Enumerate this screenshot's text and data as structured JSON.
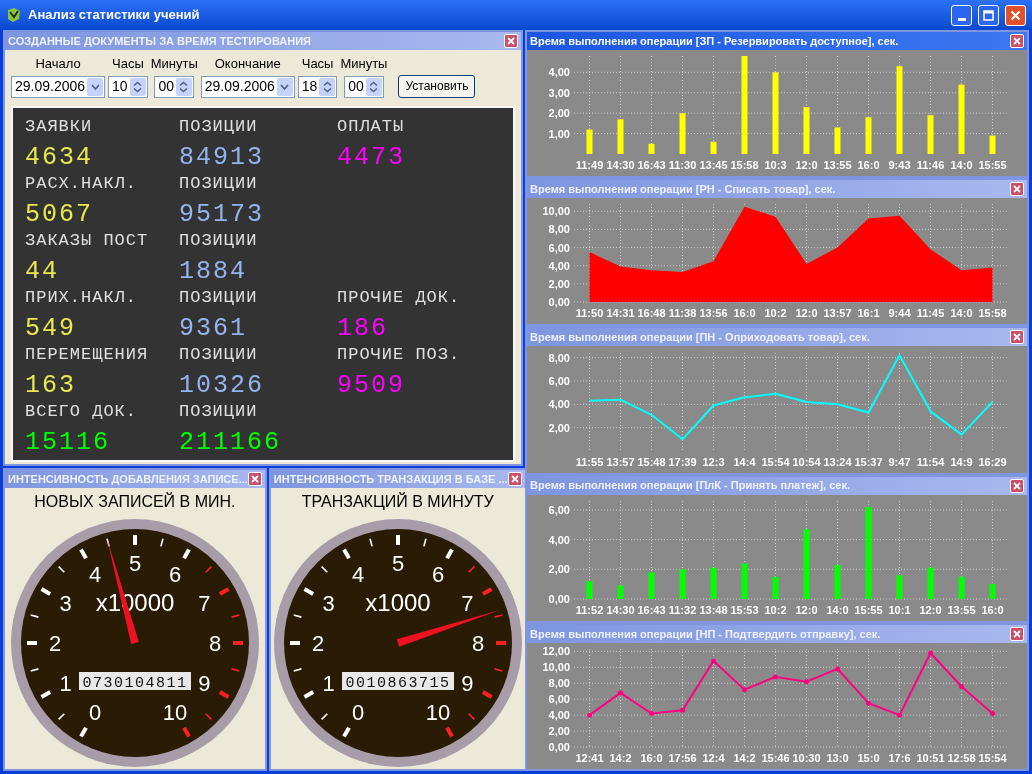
{
  "window": {
    "title": "Анализ статистики учений"
  },
  "documents_panel": {
    "title": "СОЗДАННЫЕ ДОКУМЕНТЫ ЗА ВРЕМЯ ТЕСТИРОВАНИЯ",
    "fields": [
      {
        "kind": "date",
        "label": "Начало",
        "value": "29.09.2006"
      },
      {
        "kind": "spin",
        "label": "Часы",
        "value": "10"
      },
      {
        "kind": "spin",
        "label": "Минуты",
        "value": "00"
      },
      {
        "kind": "date",
        "label": "Окончание",
        "value": "29.09.2006"
      },
      {
        "kind": "spin",
        "label": "Часы",
        "value": "18"
      },
      {
        "kind": "spin",
        "label": "Минуты",
        "value": "00"
      }
    ],
    "button": "Установить",
    "display": [
      {
        "cells": [
          {
            "label": "ЗАЯВКИ",
            "value": "4634",
            "color": "#e8e850"
          },
          {
            "label": "ПОЗИЦИИ",
            "value": "84913",
            "color": "#94b4f0"
          },
          {
            "label": "ОПЛАТЫ",
            "value": "4473",
            "color": "#ff00ff"
          }
        ]
      },
      {
        "cells": [
          {
            "label": "РАСХ.НАКЛ.",
            "value": "5067",
            "color": "#e8e850"
          },
          {
            "label": "ПОЗИЦИИ",
            "value": "95173",
            "color": "#94b4f0"
          }
        ]
      },
      {
        "cells": [
          {
            "label": "ЗАКАЗЫ ПОСТ",
            "value": "44",
            "color": "#e8e850"
          },
          {
            "label": "ПОЗИЦИИ",
            "value": "1884",
            "color": "#94b4f0"
          }
        ]
      },
      {
        "cells": [
          {
            "label": "ПРИХ.НАКЛ.",
            "value": "549",
            "color": "#e8e850"
          },
          {
            "label": "ПОЗИЦИИ",
            "value": "9361",
            "color": "#94b4f0"
          },
          {
            "label": "ПРОЧИЕ ДОК.",
            "value": "186",
            "color": "#ff00ff"
          }
        ]
      },
      {
        "cells": [
          {
            "label": "ПЕРЕМЕЩЕНИЯ",
            "value": "163",
            "color": "#e8e850"
          },
          {
            "label": "ПОЗИЦИИ",
            "value": "10326",
            "color": "#94b4f0"
          },
          {
            "label": "ПРОЧИЕ ПОЗ.",
            "value": "9509",
            "color": "#ff00ff"
          }
        ]
      },
      {
        "cells": [
          {
            "label": "ВСЕГО ДОК.",
            "value": "15116",
            "color": "#00ff00"
          },
          {
            "label": "ПОЗИЦИИ",
            "value": "211166",
            "color": "#00ff00"
          }
        ]
      }
    ]
  },
  "gauges": [
    {
      "title": "ИНТЕНСИВНОСТЬ ДОБАВЛЕНИЯ ЗАПИСЕ...",
      "caption": "НОВЫХ ЗАПИСЕЙ В МИН.",
      "multiplier": "x10000",
      "counter": "0730104811",
      "level": 0.45,
      "scale": [
        {
          "text": "0",
          "color": "#ffffff"
        },
        {
          "text": "1",
          "color": "#ffffff"
        },
        {
          "text": "2",
          "color": "#ffffff"
        },
        {
          "text": "3",
          "color": "#ffffff"
        },
        {
          "text": "4",
          "color": "#ffffff"
        },
        {
          "text": "5",
          "color": "#ffffff"
        },
        {
          "text": "6",
          "color": "#ffffff"
        },
        {
          "text": "7",
          "color": "#ff2020"
        },
        {
          "text": "8",
          "color": "#ff2020"
        },
        {
          "text": "9",
          "color": "#ff2020"
        },
        {
          "text": "10",
          "color": "#ff2020"
        }
      ]
    },
    {
      "title": "ИНТЕНСИВНОСТЬ ТРАНЗАКЦИЯ В БАЗЕ ...",
      "caption": "ТРАНЗАКЦИЙ В МИНУТУ",
      "multiplier": "x1000",
      "counter": "0010863715",
      "level": 0.74,
      "scale": [
        {
          "text": "0",
          "color": "#ffffff"
        },
        {
          "text": "1",
          "color": "#ffffff"
        },
        {
          "text": "2",
          "color": "#ffffff"
        },
        {
          "text": "3",
          "color": "#ffffff"
        },
        {
          "text": "4",
          "color": "#ffffff"
        },
        {
          "text": "5",
          "color": "#ffffff"
        },
        {
          "text": "6",
          "color": "#ffffff"
        },
        {
          "text": "7",
          "color": "#ff2020"
        },
        {
          "text": "8",
          "color": "#ff2020"
        },
        {
          "text": "9",
          "color": "#ff2020"
        },
        {
          "text": "10",
          "color": "#ff2020"
        }
      ]
    }
  ],
  "charts": [
    {
      "title": "Время выполнения операции  [ЗП - Резервировать доступное], сек.",
      "active": true,
      "chart_data": {
        "type": "bar",
        "grid": true,
        "ylim": [
          0,
          4.8
        ],
        "yticks": [
          {
            "value": 1,
            "label": "1,00"
          },
          {
            "value": 2,
            "label": "2,00"
          },
          {
            "value": 3,
            "label": "3,00"
          },
          {
            "value": 4,
            "label": "4,00"
          }
        ],
        "categories": [
          "11:49",
          "14:30",
          "16:43",
          "11:30",
          "13:45",
          "15:58",
          "10:3",
          "12:0",
          "13:55",
          "16:0",
          "9:43",
          "11:46",
          "14:0",
          "15:55"
        ],
        "series": [
          {
            "color": "#ffff00",
            "values": [
              1.2,
              1.7,
              0.5,
              2.0,
              0.6,
              4.8,
              4.0,
              2.3,
              1.3,
              1.8,
              4.3,
              1.9,
              3.4,
              0.9
            ]
          }
        ]
      }
    },
    {
      "title": "Время выполнения операции  [РН - Списать товар], сек.",
      "active": false,
      "chart_data": {
        "type": "area",
        "grid": true,
        "ylim": [
          0,
          10.8
        ],
        "yticks": [
          {
            "value": 0,
            "label": "0,00"
          },
          {
            "value": 2,
            "label": "2,00"
          },
          {
            "value": 4,
            "label": "4,00"
          },
          {
            "value": 6,
            "label": "6,00"
          },
          {
            "value": 8,
            "label": "8,00"
          },
          {
            "value": 10,
            "label": "10,00"
          }
        ],
        "categories": [
          "11:50",
          "14:31",
          "16:48",
          "11:38",
          "13:56",
          "16:0",
          "10:2",
          "12:0",
          "13:57",
          "16:1",
          "9:44",
          "11:45",
          "14:0",
          "15:58"
        ],
        "series": [
          {
            "color": "#ff0000",
            "values": [
              5.5,
              3.9,
              3.5,
              3.3,
              4.5,
              10.5,
              9.4,
              4.2,
              6.0,
              9.2,
              9.5,
              5.8,
              3.5,
              3.8
            ]
          }
        ]
      }
    },
    {
      "title": "Время выполнения операции  [ПН - Оприходовать товар], сек.",
      "active": false,
      "chart_data": {
        "type": "line",
        "grid": true,
        "ylim": [
          0,
          8.4
        ],
        "yticks": [
          {
            "value": 2,
            "label": "2,00"
          },
          {
            "value": 4,
            "label": "4,00"
          },
          {
            "value": 6,
            "label": "6,00"
          },
          {
            "value": 8,
            "label": "8,00"
          }
        ],
        "categories": [
          "11:55",
          "13:57",
          "15:48",
          "17:39",
          "12:3",
          "14:4",
          "15:54",
          "10:54",
          "13:24",
          "15:37",
          "9:47",
          "11:54",
          "14:9",
          "16:29"
        ],
        "series": [
          {
            "color": "#00ffff",
            "values": [
              4.3,
              4.4,
              3.1,
              1.0,
              3.9,
              4.6,
              4.9,
              4.2,
              4.0,
              3.3,
              8.2,
              3.4,
              1.4,
              4.2
            ]
          }
        ]
      }
    },
    {
      "title": "Время выполнения операции  [ПлК - Принять платеж], сек.",
      "active": false,
      "chart_data": {
        "type": "bar",
        "grid": true,
        "ylim": [
          0,
          6.6
        ],
        "yticks": [
          {
            "value": 0,
            "label": "0,00"
          },
          {
            "value": 2,
            "label": "2,00"
          },
          {
            "value": 4,
            "label": "4,00"
          },
          {
            "value": 6,
            "label": "6,00"
          }
        ],
        "categories": [
          "11:52",
          "14:30",
          "16:43",
          "11:32",
          "13:48",
          "15:53",
          "10:2",
          "12:0",
          "14:0",
          "15:55",
          "10:1",
          "12:0",
          "13:55",
          "16:0"
        ],
        "series": [
          {
            "color": "#00ff00",
            "values": [
              1.2,
              0.9,
              1.8,
              2.0,
              2.1,
              2.4,
              1.5,
              4.7,
              2.3,
              6.2,
              1.6,
              2.1,
              1.5,
              1.0
            ]
          }
        ]
      }
    },
    {
      "title": "Время выполнения операции  [НП - Подтвердить отправку], сек.",
      "active": false,
      "chart_data": {
        "type": "line",
        "grid": true,
        "ylim": [
          0,
          12.3
        ],
        "yticks": [
          {
            "value": 0,
            "label": "0,00"
          },
          {
            "value": 2,
            "label": "2,00"
          },
          {
            "value": 4,
            "label": "4,00"
          },
          {
            "value": 6,
            "label": "6,00"
          },
          {
            "value": 8,
            "label": "8,00"
          },
          {
            "value": 10,
            "label": "10,00"
          },
          {
            "value": 12,
            "label": "12,00"
          }
        ],
        "categories": [
          "12:41",
          "14:2",
          "16:0",
          "17:56",
          "12:4",
          "14:2",
          "15:46",
          "10:30",
          "13:0",
          "15:0",
          "17:6",
          "10:51",
          "12:58",
          "15:54"
        ],
        "series": [
          {
            "color": "#ff0080",
            "values": [
              4.0,
              6.8,
              4.2,
              4.6,
              10.8,
              7.2,
              8.8,
              8.2,
              9.8,
              5.5,
              4.0,
              11.8,
              7.6,
              4.2
            ]
          }
        ]
      }
    }
  ]
}
